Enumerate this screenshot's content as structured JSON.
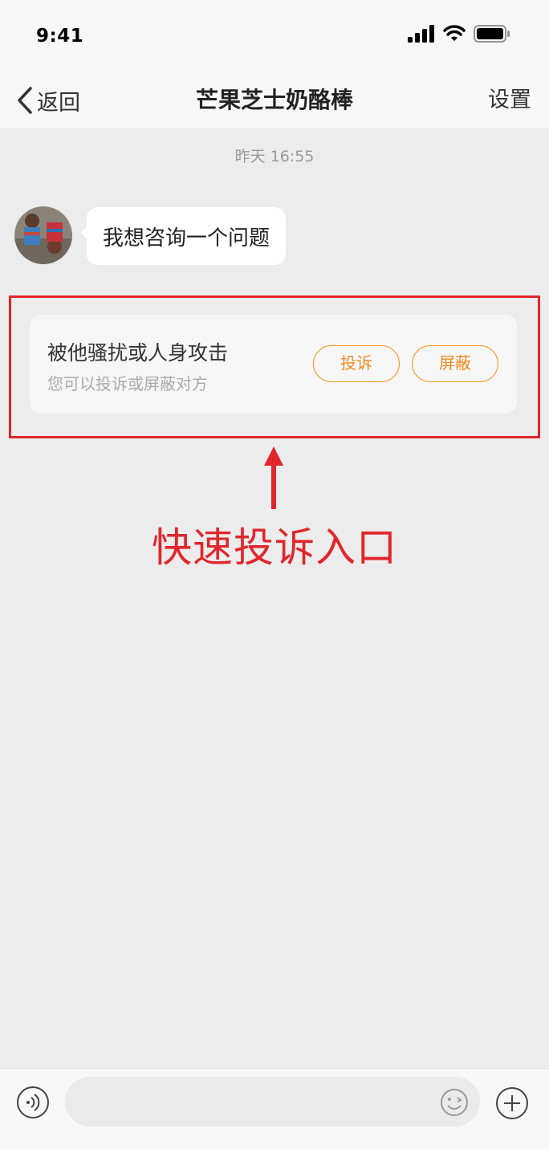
{
  "status_bar": {
    "time": "9:41"
  },
  "nav": {
    "back_label": "返回",
    "title": "芒果芝士奶酪棒",
    "settings_label": "设置"
  },
  "conversation": {
    "timestamp": "昨天 16:55",
    "messages": [
      {
        "from": "contact",
        "text": "我想咨询一个问题"
      }
    ]
  },
  "report_card": {
    "title": "被他骚扰或人身攻击",
    "subtitle": "您可以投诉或屏蔽对方",
    "report_label": "投诉",
    "block_label": "屏蔽"
  },
  "annotation": {
    "label": "快速投诉入口",
    "color": "#e0262b"
  },
  "input_bar": {
    "placeholder": ""
  },
  "colors": {
    "accent": "#f08a1c",
    "background": "#ececec"
  },
  "icons": [
    "signal-icon",
    "wifi-icon",
    "battery-icon",
    "back-chevron-icon",
    "voice-icon",
    "emoji-icon",
    "plus-icon"
  ]
}
